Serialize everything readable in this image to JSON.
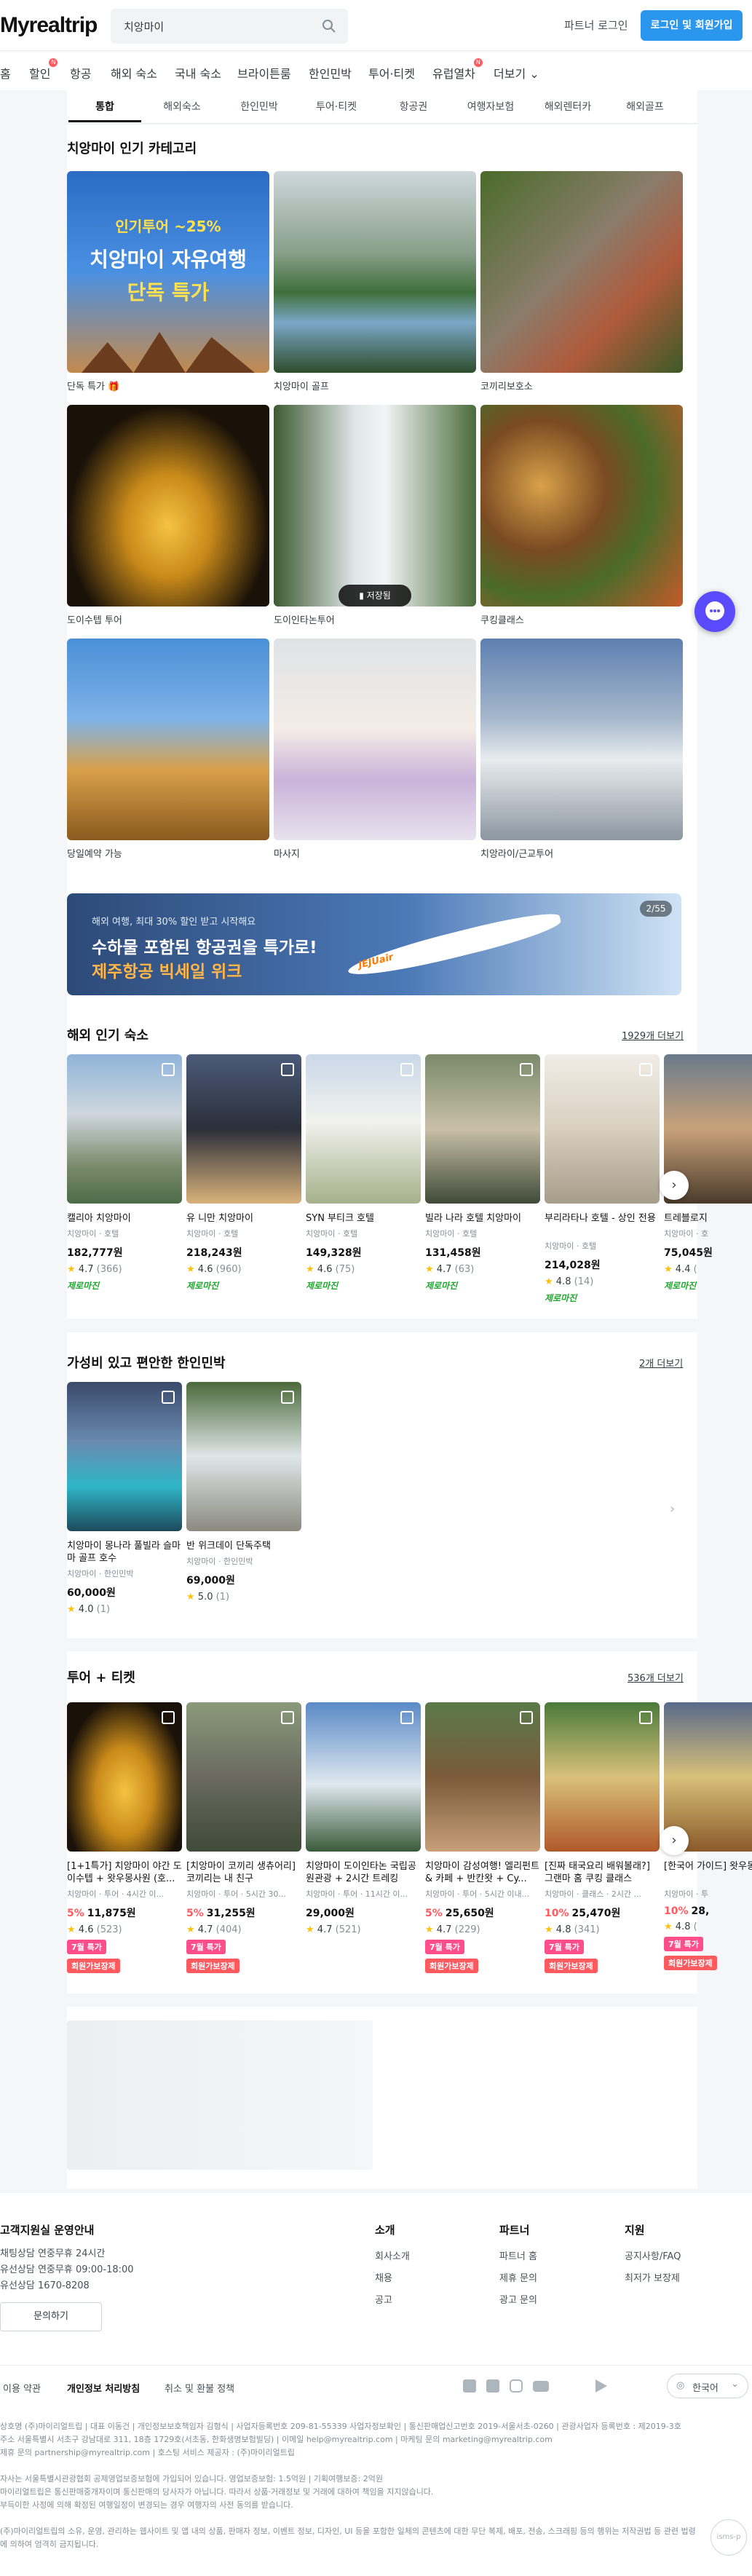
{
  "header": {
    "logo": "Myrealtrip",
    "search_value": "치앙마이",
    "partner_login": "파트너 로그인",
    "login_button": "로그인 및 회원가입"
  },
  "gnb": [
    {
      "label": "홈"
    },
    {
      "label": "할인"
    },
    {
      "label": "항공"
    },
    {
      "label": "해외 숙소"
    },
    {
      "label": "국내 숙소"
    },
    {
      "label": "브라이튼룸"
    },
    {
      "label": "한인민박"
    },
    {
      "label": "투어·티켓"
    },
    {
      "label": "유럽열차"
    },
    {
      "label": "더보기"
    }
  ],
  "subtabs": [
    "통합",
    "해외숙소",
    "한인민박",
    "투어·티켓",
    "항공권",
    "여행자보험",
    "해외렌터카",
    "해외골프"
  ],
  "categories": {
    "title": "치앙마이 인기 카테고리",
    "banner_text1": "인기투어 ~25%",
    "banner_text2": "치앙마이 자유여행",
    "banner_text3": "단독 특가",
    "save_label": "저장됨",
    "items": [
      {
        "label": "단독 특가 🎁"
      },
      {
        "label": "치앙마이 골프"
      },
      {
        "label": "코끼리보호소"
      },
      {
        "label": "도이수텝 투어"
      },
      {
        "label": "도이인타논투어"
      },
      {
        "label": "쿠킹클래스"
      },
      {
        "label": "당일예약 가능"
      },
      {
        "label": "마사지"
      },
      {
        "label": "치앙라이/근교투어"
      }
    ]
  },
  "promo": {
    "small": "해외 여행, 최대 30% 할인 받고 시작해요",
    "line1": "수하물 포함된 항공권을 특가로!",
    "line2": "제주항공 빅세일 위크",
    "counter": "2/55",
    "airline": "JEJUair"
  },
  "hotels": {
    "title": "해외 인기 숙소",
    "more": "1929개 더보기",
    "items": [
      {
        "name": "캘리아 치앙마이",
        "sub": "치앙마이 · 호텔",
        "price": "182,777원",
        "rating": "4.7",
        "count": "(366)",
        "tag": "제로마진"
      },
      {
        "name": "유 니만 치앙마이",
        "sub": "치앙마이 · 호텔",
        "price": "218,243원",
        "rating": "4.6",
        "count": "(960)",
        "tag": "제로마진"
      },
      {
        "name": "SYN 부티크 호텔",
        "sub": "치앙마이 · 호텔",
        "price": "149,328원",
        "rating": "4.6",
        "count": "(75)",
        "tag": "제로마진"
      },
      {
        "name": "빌라 나라 호텔 치앙마이",
        "sub": "치앙마이 · 호텔",
        "price": "131,458원",
        "rating": "4.7",
        "count": "(63)",
        "tag": "제로마진"
      },
      {
        "name": "부리라타나 호텔 - 상인 전용",
        "sub": "치앙마이 · 호텔",
        "price": "214,028원",
        "rating": "4.8",
        "count": "(14)",
        "tag": "제로마진"
      },
      {
        "name": "트레블로지",
        "sub": "치앙마이 · 호",
        "price": "75,045원",
        "rating": "4.4",
        "count": "(",
        "tag": "제로마진"
      }
    ]
  },
  "minbak": {
    "title": "가성비 있고 편안한 한인민박",
    "more": "2개 더보기",
    "items": [
      {
        "name": "치앙마이 몽나라 풀빌라 슬마마 골프 호수",
        "sub": "치앙마이 · 한인민박",
        "price": "60,000원",
        "rating": "4.0",
        "count": "(1)"
      },
      {
        "name": "반 위크데이 단독주택",
        "sub": "치앙마이 · 한인민박",
        "price": "69,000원",
        "rating": "5.0",
        "count": "(1)"
      }
    ]
  },
  "tours": {
    "title": "투어 + 티켓",
    "more": "536개 더보기",
    "items": [
      {
        "name": "[1+1특가] 치앙마이 야간 도이수텝 + 왓우몽사원 (호...",
        "sub": "치앙마이 · 투어 · 4시간 이...",
        "disc": "5%",
        "price": "11,875원",
        "rating": "4.6",
        "count": "(523)",
        "badge1": "7월 특가",
        "badge2": "회원가보장제"
      },
      {
        "name": "[치앙마이 코끼리 생츄어리] 코끼리는 내 친구",
        "sub": "치앙마이 · 투어 · 5시간 30...",
        "disc": "5%",
        "price": "31,255원",
        "rating": "4.7",
        "count": "(404)",
        "badge1": "7월 특가",
        "badge2": "회원가보장제"
      },
      {
        "name": "치앙마이 도이인타논 국립공원관광 + 2시간 트레킹",
        "sub": "치앙마이 · 투어 · 11시간 이...",
        "disc": "",
        "price": "29,000원",
        "rating": "4.7",
        "count": "(521)",
        "badge1": "",
        "badge2": ""
      },
      {
        "name": "치앙마이 감성여행! 엘리펀트 & 카페 + 반칸왓 + Cy...",
        "sub": "치앙마이 · 투어 · 5시간 이내...",
        "disc": "5%",
        "price": "25,650원",
        "rating": "4.7",
        "count": "(229)",
        "badge1": "7월 특가",
        "badge2": "회원가보장제"
      },
      {
        "name": "[진짜 태국요리 배워볼래?] 그랜마 홈 쿠킹 클래스",
        "sub": "치앙마이 · 클래스 · 2시간 ...",
        "disc": "10%",
        "price": "25,470원",
        "rating": "4.8",
        "count": "(341)",
        "badge1": "7월 특가",
        "badge2": "회원가보장제"
      },
      {
        "name": "[한국어 가이드] 왓우몽 & 도",
        "sub": "치앙마이 · 투",
        "disc": "10%",
        "price": "28,",
        "rating": "4.8",
        "count": "(",
        "badge1": "7월 특가",
        "badge2": "회원가보장제"
      }
    ]
  },
  "footer": {
    "cs_title": "고객지원실 운영안내",
    "cs_lines": [
      "채팅상담 연중무휴 24시간",
      "유선상담 연중무휴 09:00-18:00",
      "유선상담 1670-8208"
    ],
    "contact_button": "문의하기",
    "col1_title": "소개",
    "col1": [
      "회사소개",
      "채용",
      "공고"
    ],
    "col2_title": "파트너",
    "col2": [
      "파트너 홈",
      "제휴 문의",
      "광고 문의"
    ],
    "col3_title": "지원",
    "col3": [
      "공지사항/FAQ",
      "최저가 보장제"
    ],
    "links": [
      "이용 약관",
      "개인정보 처리방침",
      "취소 및 환불 정책"
    ],
    "language": "한국어",
    "legal": [
      "상호명 (주)마이리얼트립 | 대표 이동건 | 개인정보보호책임자 김형식 | 사업자등록번호 209-81-55339 사업자정보확인 | 통신판매업신고번호 2019-서울서초-0260 | 관광사업자 등록번호 : 제2019-3호",
      "주소 서울특별시 서초구 강남대로 311, 18층 1729호(서초동, 한화생명보험빌딩) | 이메일 help@myrealtrip.com | 마케팅 문의 marketing@myrealtrip.com",
      "제휴 문의 partnership@myrealtrip.com | 호스팅 서비스 제공자 : (주)마이리얼트립",
      "자사는 서울특별시관광협회 공제영업보증보험에 가입되어 있습니다. 영업보증보험: 1.5억원 | 기획여행보증: 2억원",
      "마이리얼트립은 통신판매중개자이며 통신판매의 당사자가 아닙니다. 따라서 상품·거래정보 및 거래에 대하여 책임을 지지않습니다.",
      "부득이한 사정에 의해 확정된 여행일정이 변경되는 경우 여행자의 사전 동의를 받습니다.",
      "(주)마이리얼트립의 소유, 운영, 관리하는 웹사이트 및 앱 내의 상품, 판매자 정보, 이벤트 정보, 디자인, UI 등을 포함한 일체의 콘텐츠에 대한 무단 복제, 배포, 전송, 스크래핑 등의 행위는 저작권법 등 관련 법령에 의하여 엄격히 금지됩니다."
    ],
    "isms": "isms-p"
  },
  "colors": {
    "primary": "#2b96ed",
    "discount": "#ff5a5f",
    "zero_margin": "#1fa82e",
    "badge": "#ff4f8b",
    "chat": "#5b4bff"
  }
}
